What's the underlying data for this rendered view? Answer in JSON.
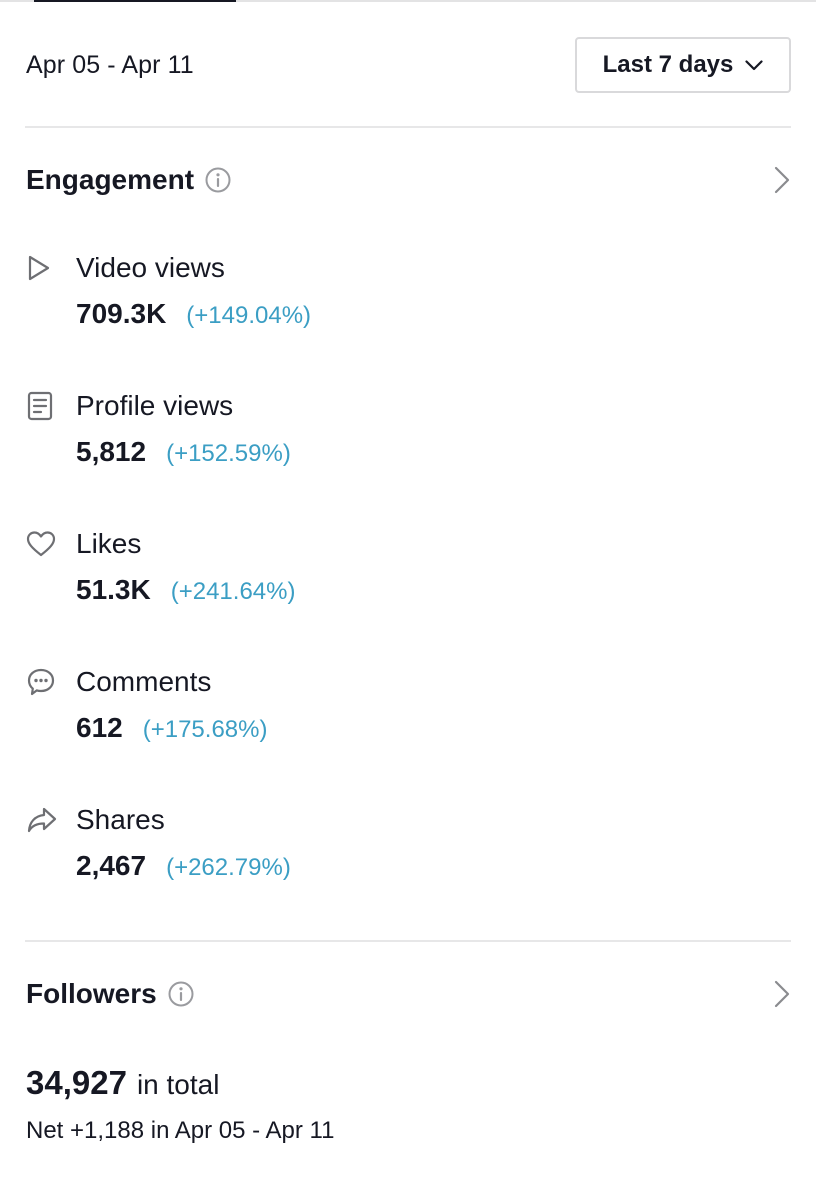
{
  "date_range": "Apr 05 - Apr 11",
  "range_selector": {
    "label": "Last 7 days",
    "icon": "chevron-down-icon"
  },
  "engagement": {
    "title": "Engagement",
    "info_icon": "info-icon",
    "nav_icon": "chevron-right-icon",
    "metrics": [
      {
        "icon": "play-icon",
        "label": "Video views",
        "value": "709.3K",
        "change": "(+149.04%)"
      },
      {
        "icon": "profile-icon",
        "label": "Profile views",
        "value": "5,812",
        "change": "(+152.59%)"
      },
      {
        "icon": "heart-icon",
        "label": "Likes",
        "value": "51.3K",
        "change": "(+241.64%)"
      },
      {
        "icon": "comment-icon",
        "label": "Comments",
        "value": "612",
        "change": "(+175.68%)"
      },
      {
        "icon": "share-icon",
        "label": "Shares",
        "value": "2,467",
        "change": "(+262.79%)"
      }
    ]
  },
  "followers": {
    "title": "Followers",
    "info_icon": "info-icon",
    "nav_icon": "chevron-right-icon",
    "total": "34,927",
    "total_suffix": "in total",
    "net": "Net +1,188 in Apr 05 - Apr 11"
  },
  "colors": {
    "text": "#161823",
    "change": "#3b9ec4",
    "divider": "#e7e7e8",
    "icon": "#6e6f73"
  }
}
